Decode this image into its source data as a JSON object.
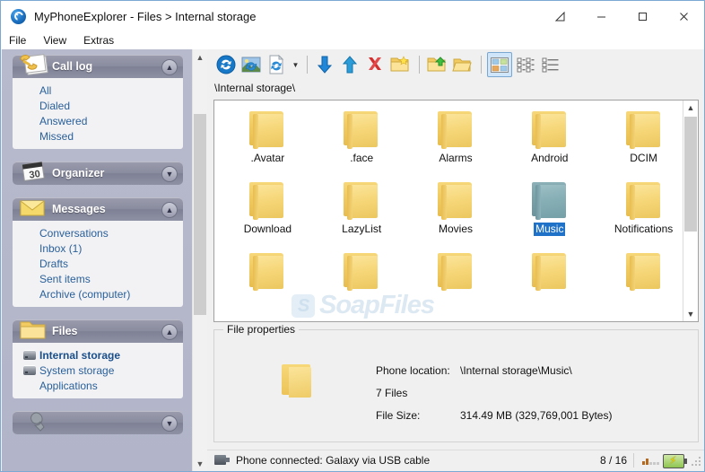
{
  "window": {
    "title": "MyPhoneExplorer -  Files > Internal storage",
    "app_icon": "refresh-globe-icon",
    "controls": [
      {
        "name": "restore-down-button",
        "glyph": "resize-triangle-icon"
      },
      {
        "name": "minimize-button",
        "glyph": "minimize-icon"
      },
      {
        "name": "maximize-button",
        "glyph": "maximize-icon"
      },
      {
        "name": "close-button",
        "glyph": "close-icon"
      }
    ]
  },
  "menu": {
    "items": [
      "File",
      "View",
      "Extras"
    ]
  },
  "sidebar": {
    "panels": [
      {
        "title": "Call log",
        "icon": "call-log-icon",
        "expanded": true,
        "toggle": "chevron-up-icon",
        "items": [
          {
            "label": "All",
            "icon": null,
            "selected": false
          },
          {
            "label": "Dialed",
            "icon": null,
            "selected": false
          },
          {
            "label": "Answered",
            "icon": null,
            "selected": false
          },
          {
            "label": "Missed",
            "icon": null,
            "selected": false
          }
        ]
      },
      {
        "title": "Organizer",
        "icon": "calendar-icon",
        "expanded": false,
        "toggle": "chevron-down-icon",
        "items": []
      },
      {
        "title": "Messages",
        "icon": "envelope-icon",
        "expanded": true,
        "toggle": "chevron-up-icon",
        "items": [
          {
            "label": "Conversations",
            "icon": null,
            "selected": false
          },
          {
            "label": "Inbox (1)",
            "icon": null,
            "selected": false
          },
          {
            "label": "Drafts",
            "icon": null,
            "selected": false
          },
          {
            "label": "Sent items",
            "icon": null,
            "selected": false
          },
          {
            "label": "Archive (computer)",
            "icon": null,
            "selected": false
          }
        ]
      },
      {
        "title": "Files",
        "icon": "folder-icon",
        "expanded": true,
        "toggle": "chevron-up-icon",
        "items": [
          {
            "label": "Internal storage",
            "icon": "drive-icon",
            "selected": true
          },
          {
            "label": "System storage",
            "icon": "drive-icon",
            "selected": false
          },
          {
            "label": "Applications",
            "icon": null,
            "selected": false
          }
        ]
      },
      {
        "title": "",
        "icon": "wrench-icon",
        "expanded": false,
        "toggle": "chevron-down-icon",
        "items": []
      }
    ],
    "scrollbar": {
      "up": "chevron-up-icon",
      "down": "chevron-down-icon"
    }
  },
  "toolbar": {
    "buttons": [
      {
        "name": "sync-button",
        "icon": "blue-refresh-globe-icon"
      },
      {
        "name": "refresh-phone-button",
        "icon": "refresh-photo-icon"
      },
      {
        "name": "refresh-file-button",
        "icon": "refresh-page-icon"
      },
      {
        "name": "refresh-dropdown-button",
        "icon": "caret-down-icon"
      },
      {
        "name": "download-button",
        "icon": "arrow-down-icon"
      },
      {
        "name": "upload-button",
        "icon": "arrow-up-icon"
      },
      {
        "name": "delete-button",
        "icon": "red-x-icon"
      },
      {
        "name": "new-folder-button",
        "icon": "folder-new-icon"
      },
      {
        "name": "open-folder-button",
        "icon": "folder-open-arrow-icon"
      },
      {
        "name": "up-folder-button",
        "icon": "folder-up-icon"
      },
      {
        "name": "view-thumbnails-button",
        "icon": "thumbnails-view-icon",
        "active": true
      },
      {
        "name": "view-tiles-button",
        "icon": "tiles-view-icon",
        "active": false
      },
      {
        "name": "view-list-button",
        "icon": "list-view-icon",
        "active": false
      }
    ]
  },
  "path_bar": {
    "path": "\\Internal storage\\"
  },
  "file_list": {
    "watermark": "SoapFiles",
    "watermark_badge": "S",
    "rows": [
      [
        {
          "label": ".Avatar",
          "selected": false
        },
        {
          "label": ".face",
          "selected": false
        },
        {
          "label": "Alarms",
          "selected": false
        },
        {
          "label": "Android",
          "selected": false
        },
        {
          "label": "DCIM",
          "selected": false
        }
      ],
      [
        {
          "label": "Download",
          "selected": false
        },
        {
          "label": "LazyList",
          "selected": false
        },
        {
          "label": "Movies",
          "selected": false
        },
        {
          "label": "Music",
          "selected": true
        },
        {
          "label": "Notifications",
          "selected": false
        }
      ],
      [
        {
          "label": "",
          "selected": false
        },
        {
          "label": "",
          "selected": false
        },
        {
          "label": "",
          "selected": false
        },
        {
          "label": "",
          "selected": false
        },
        {
          "label": "",
          "selected": false
        }
      ]
    ],
    "scrollbar": {
      "up": "chevron-up-icon",
      "down": "chevron-down-icon"
    }
  },
  "file_properties": {
    "legend": "File properties",
    "icon": "folder-icon",
    "rows": [
      {
        "label": "Phone location:",
        "value": "\\Internal storage\\Music\\"
      },
      {
        "label": "7 Files",
        "value": ""
      },
      {
        "label": "File Size:",
        "value": "314.49 MB  (329,769,001 Bytes)"
      }
    ]
  },
  "status_bar": {
    "icon": "usb-cable-icon",
    "text": "Phone connected: Galaxy via USB cable",
    "count": "8 / 16",
    "signal_icon": "signal-bars-icon",
    "battery_icon": "battery-charging-icon",
    "grip_icon": "resize-grip-icon"
  },
  "colors": {
    "selection_blue": "#1f72c8",
    "folder_yellow": "#f2cc62",
    "selected_folder_teal": "#7aa3aa",
    "sidebar_bg": "#b2b5c9",
    "panel_header": "#8a8c9f",
    "link_blue": "#2a6099"
  }
}
